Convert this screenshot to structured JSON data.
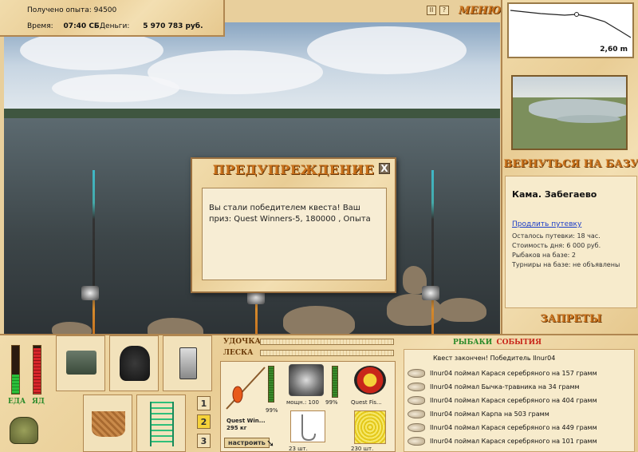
{
  "header": {
    "xp_label": "Получено опыта:",
    "xp_value": "94500",
    "time_label": "Время:",
    "time_value": "07:40 СБ",
    "money_label": "Деньги:",
    "money_value": "5 970 783 руб."
  },
  "menu": {
    "pause_label": "II",
    "help_label": "?",
    "menu_label": "МЕНЮ"
  },
  "depth": {
    "value": "2,60 m"
  },
  "sidebar": {
    "return_label": "ВЕРНУТЬСЯ НА БАЗУ",
    "location_name": "Кама. Забегаево",
    "extend_link": "Продлить путевку",
    "info_lines": [
      "Осталось путевки: 18 час.",
      "Стоимость дня: 6 000 руб.",
      "Рыбаков на базе: 2",
      "Турниры на базе: не объявлены"
    ],
    "bans_label": "ЗАПРЕТЫ"
  },
  "dialog": {
    "title": "ПРЕДУПРЕЖДЕНИЕ",
    "close_label": "X",
    "message": "Вы стали победителем квеста! Ваш приз: Quest Winners-5, 180000 , Опыта"
  },
  "meters": {
    "food_label": "ЕДА",
    "stamina_label": "ЯД",
    "food_level": 0.4,
    "stamina_level": 0.95
  },
  "slots": {
    "numbers": [
      "1",
      "2",
      "3"
    ],
    "active_number": "2"
  },
  "tackle": {
    "rod_label": "УДОЧКА",
    "line_label": "ЛЕСКА",
    "rod_name": "Quest Win...",
    "rod_weight": "295 кг",
    "rod_pct": "99%",
    "reel_text": "мощн.: 100",
    "reel_pct": "99%",
    "line_name": "Quest Fis...",
    "hook_count": "23 шт.",
    "bait_count": "230 шт.",
    "setup_label": "настроить"
  },
  "events": {
    "tab_fishers": "РЫБАКИ",
    "tab_events": "СОБЫТИЯ",
    "quest_line": "Квест закончен! Победитель Ilnur04",
    "rows": [
      "Ilnur04 поймал Карася серебряного на 157 грамм",
      "Ilnur04 поймал Бычка-травника на 34 грамм",
      "Ilnur04 поймал Карася серебряного на 404 грамм",
      "Ilnur04 поймал Карпа на 503 грамм",
      "Ilnur04 поймал Карася серебряного на 449 грамм",
      "Ilnur04 поймал Карася серебряного на 101 грамм"
    ]
  },
  "colors": {
    "wood": "#ecd39f",
    "title_orange": "#c8701a",
    "meter_green": "#2bbf3a",
    "meter_red": "#d8262a"
  }
}
